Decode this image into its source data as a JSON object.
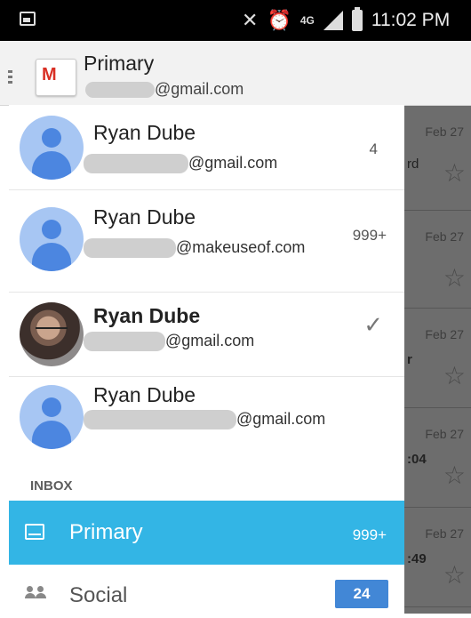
{
  "status_bar": {
    "time": "11:02 PM",
    "network": "4G"
  },
  "header": {
    "title": "Primary",
    "email_suffix": "@gmail.com"
  },
  "accounts": [
    {
      "name": "Ryan Dube",
      "email_suffix": "@gmail.com",
      "count": "4",
      "active": false
    },
    {
      "name": "Ryan Dube",
      "email_suffix": "@makeuseof.com",
      "count": "999+",
      "active": false
    },
    {
      "name": "Ryan Dube",
      "email_suffix": "@gmail.com",
      "count": "",
      "active": true
    },
    {
      "name": "Ryan Dube",
      "email_suffix": "@gmail.com",
      "count": "",
      "active": false
    }
  ],
  "section_label": "INBOX",
  "nav": {
    "primary": {
      "label": "Primary",
      "count": "999+"
    },
    "social": {
      "label": "Social",
      "count": "24"
    }
  },
  "background_list": [
    {
      "date": "Feb 27",
      "snippet": "rd"
    },
    {
      "date": "Feb 27",
      "snippet": ""
    },
    {
      "date": "Feb 27",
      "snippet": "r"
    },
    {
      "date": "Feb 27",
      "snippet": ":04"
    },
    {
      "date": "Feb 27",
      "snippet": ":49"
    }
  ],
  "colors": {
    "accent": "#33b5e5",
    "badge": "#4287d6",
    "avatar_bg": "#a7c6f3",
    "avatar_fg": "#4c86e0"
  }
}
